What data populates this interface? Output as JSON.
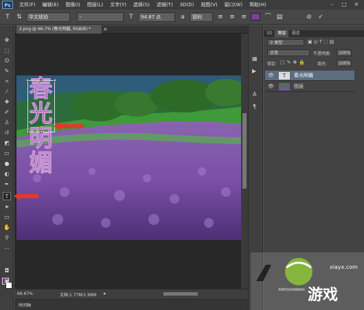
{
  "menu": {
    "logo": "Ps",
    "items": [
      "文件(F)",
      "编辑(E)",
      "图像(I)",
      "图层(L)",
      "文字(Y)",
      "选择(S)",
      "滤镜(T)",
      "3D(D)",
      "视图(V)",
      "窗口(W)",
      "帮助(H)"
    ]
  },
  "options": {
    "font_family": "华文琥珀",
    "font_style": "-",
    "font_size": "94.87 点",
    "anti_alias": "锐利",
    "text_color": "#7b2f8c"
  },
  "document": {
    "tab_title": "2.png @ 66.7% (春光明媚, RGB/8) *",
    "text_content": [
      "春",
      "光",
      "明",
      "媚"
    ],
    "zoom": "66.67%",
    "doc_size": "文档:1.77M/1.99M"
  },
  "timeline": {
    "label": "时间轴"
  },
  "panels": {
    "top_tabs": [
      "3D",
      "图层",
      "通道"
    ],
    "filter_label": "类型",
    "blend_mode": "正常",
    "opacity_label": "不透明度:",
    "opacity_value": "100%",
    "lock_label": "锁定:",
    "fill_label": "填充:",
    "fill_value": "100%",
    "layers": [
      {
        "name": "春光明媚",
        "type": "text"
      },
      {
        "name": "图层",
        "type": "image"
      }
    ]
  },
  "watermark": {
    "text_main": "游戏",
    "text_url": "xiayx.com",
    "text_small": "XIAYOUXIWANG"
  },
  "colors": {
    "foreground": "#6e2c86",
    "background": "#ffffff",
    "accent_arrow": "#e0392b"
  }
}
